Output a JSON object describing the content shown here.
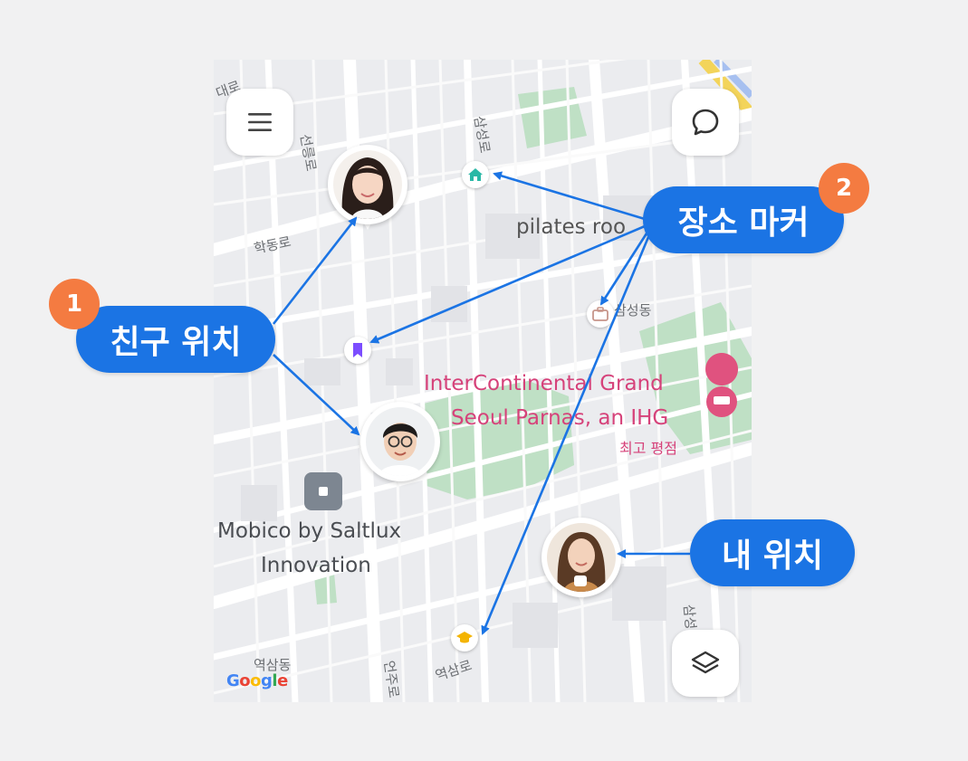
{
  "map": {
    "streets": {
      "top_left": "대로",
      "seoul_st": "선릉로",
      "hakdong": "학동로",
      "samseong": "삼성로",
      "samseong_dong": "삼성동",
      "samseong_right": "삼성로",
      "yeoksam_dong": "역삼동",
      "yeoksam_ro": "역삼로",
      "onju": "언주로"
    },
    "pois": {
      "pilates": "pilates roo",
      "hotel_line1": "InterContinental Grand",
      "hotel_line2": "Seoul Parnas, an IHG",
      "hotel_sub": "최고 평점",
      "mobico_line1": "Mobico by Saltlux",
      "mobico_line2": "Innovation"
    },
    "brand": [
      "G",
      "o",
      "o",
      "g",
      "l",
      "e"
    ]
  },
  "controls": {
    "menu_icon": "menu-icon",
    "chat_icon": "chat-bubble-icon",
    "layers_icon": "layers-icon"
  },
  "callouts": {
    "friends": {
      "label": "친구 위치",
      "badge": "1"
    },
    "places": {
      "label": "장소 마커",
      "badge": "2"
    },
    "me": {
      "label": "내 위치"
    }
  },
  "colors": {
    "accent": "#1b74e4",
    "badge": "#f47b41",
    "hotel": "#d6427a",
    "park": "#bfe0c5"
  }
}
